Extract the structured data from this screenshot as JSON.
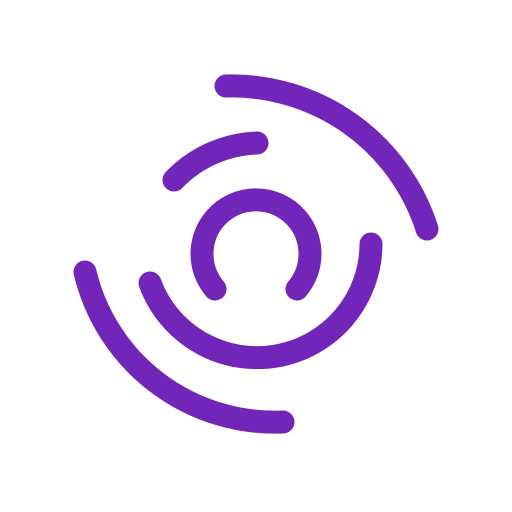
{
  "logo": {
    "icon": "concentric-arcs-logo-icon",
    "colors": {
      "accent": "#7226B9",
      "background": "#FFFFFF"
    }
  }
}
